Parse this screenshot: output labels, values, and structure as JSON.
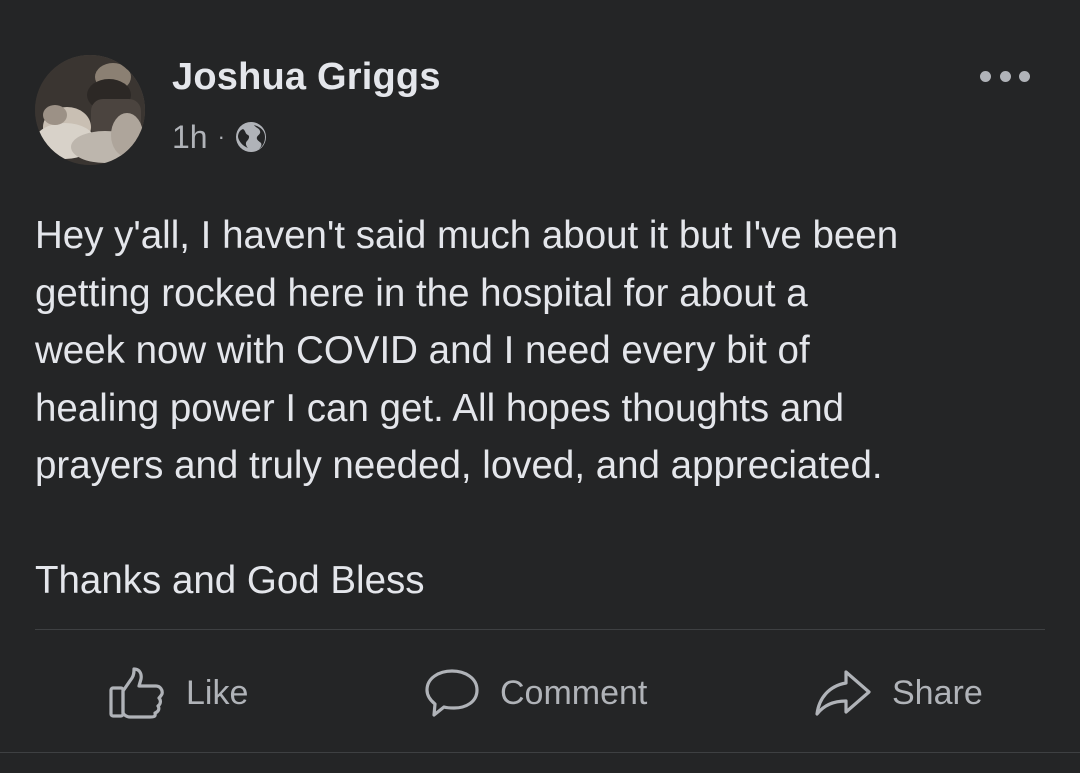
{
  "post": {
    "author": "Joshua Griggs",
    "time": "1h",
    "separator": "·",
    "privacy_icon": "globe-icon",
    "more_icon": "more-options-icon",
    "body": {
      "paragraph1": [
        "Hey y'all, I haven't said much about it but I've been",
        "getting rocked here in the hospital for about a",
        "week now with COVID and I need every bit of",
        "healing power I can get. All hopes thoughts and",
        "prayers and truly needed, loved, and appreciated."
      ],
      "paragraph2": "Thanks and God Bless"
    }
  },
  "actions": {
    "like": {
      "label": "Like",
      "icon": "thumbs-up-icon"
    },
    "comment": {
      "label": "Comment",
      "icon": "speech-bubble-icon"
    },
    "share": {
      "label": "Share",
      "icon": "share-arrow-icon"
    }
  },
  "colors": {
    "background": "#242526",
    "primary_text": "#e4e6eb",
    "secondary_text": "#b0b3b8",
    "divider": "#3e4042"
  }
}
